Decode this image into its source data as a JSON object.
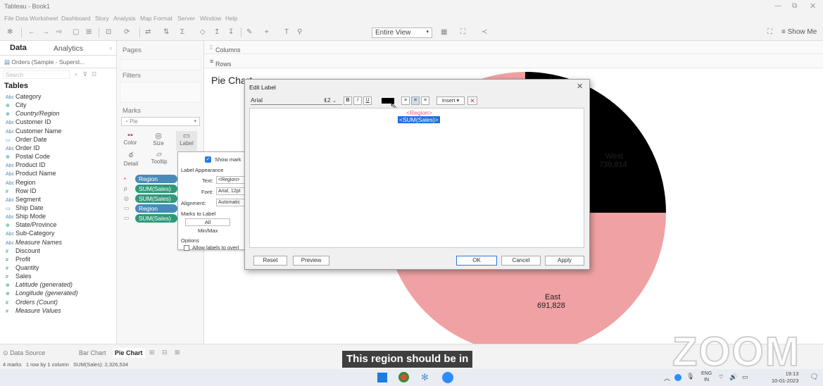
{
  "window": {
    "title": "Tableau - Book1"
  },
  "menubar": {
    "items": [
      "File",
      "Data",
      "Worksheet",
      "Dashboard",
      "Story",
      "Analysis",
      "Map",
      "Format",
      "Server",
      "Window",
      "Help"
    ]
  },
  "toolbar": {
    "view_select": "Entire View",
    "show_me": "Show Me"
  },
  "left_pane": {
    "tab_data": "Data",
    "tab_analytics": "Analytics",
    "datasource": "Orders (Sample - Superst...",
    "search_placeholder": "Search",
    "tables_header": "Tables",
    "fields": [
      {
        "icon": "Abc",
        "label": "Category"
      },
      {
        "icon": "⊕",
        "label": "City"
      },
      {
        "icon": "⊕",
        "label": "Country/Region"
      },
      {
        "icon": "Abc",
        "label": "Customer ID"
      },
      {
        "icon": "Abc",
        "label": "Customer Name"
      },
      {
        "icon": "▭",
        "label": "Order Date"
      },
      {
        "icon": "Abc",
        "label": "Order ID"
      },
      {
        "icon": "⊕",
        "label": "Postal Code"
      },
      {
        "icon": "Abc",
        "label": "Product ID"
      },
      {
        "icon": "Abc",
        "label": "Product Name"
      },
      {
        "icon": "Abc",
        "label": "Region"
      },
      {
        "icon": "#",
        "label": "Row ID"
      },
      {
        "icon": "Abc",
        "label": "Segment"
      },
      {
        "icon": "▭",
        "label": "Ship Date"
      },
      {
        "icon": "Abc",
        "label": "Ship Mode"
      },
      {
        "icon": "⊕",
        "label": "State/Province"
      },
      {
        "icon": "Abc",
        "label": "Sub-Category"
      },
      {
        "icon": "Abc",
        "label": "Measure Names"
      },
      {
        "icon": "#",
        "label": "Discount"
      },
      {
        "icon": "#",
        "label": "Profit"
      },
      {
        "icon": "#",
        "label": "Quantity"
      },
      {
        "icon": "#",
        "label": "Sales"
      },
      {
        "icon": "⊕",
        "label": "Latitude (generated)"
      },
      {
        "icon": "⊕",
        "label": "Longitude (generated)"
      },
      {
        "icon": "#",
        "label": "Orders (Count)"
      },
      {
        "icon": "#",
        "label": "Measure Values"
      }
    ]
  },
  "mid_pane": {
    "pages": "Pages",
    "filters": "Filters",
    "marks": "Marks",
    "mark_type": "Pie",
    "buttons": [
      "Color",
      "Size",
      "Label",
      "Detail",
      "Tooltip"
    ],
    "pills": [
      {
        "label": "Region",
        "color": "blue"
      },
      {
        "label": "SUM(Sales)",
        "color": "green"
      },
      {
        "label": "SUM(Sales)",
        "color": "green"
      },
      {
        "label": "Region",
        "color": "blue"
      },
      {
        "label": "SUM(Sales)",
        "color": "green"
      }
    ]
  },
  "shelves": {
    "columns": "Columns",
    "rows": "Rows"
  },
  "view": {
    "title": "Pie Chart"
  },
  "pie_labels": {
    "west_region": "West",
    "west_value": "739,814",
    "east_region": "East",
    "east_value": "691,828"
  },
  "label_popup": {
    "show_mark": "Show mark",
    "appearance": "Label Appearance",
    "text_label": "Text:",
    "text_value": "<Region>",
    "font_label": "Font:",
    "font_value": "Arial, 12pt",
    "align_label": "Alignment:",
    "align_value": "Automatic",
    "marks_to_label": "Marks to Label",
    "all": "All",
    "minmax": "Min/Max",
    "options": "Options",
    "allow": "Allow labels to overl"
  },
  "dialog": {
    "title": "Edit Label",
    "font": "Arial",
    "size": "12",
    "insert": "Insert",
    "line1": "<Region>",
    "line2": "<SUM(Sales)>",
    "reset": "Reset",
    "preview": "Preview",
    "ok": "OK",
    "cancel": "Cancel",
    "apply": "Apply"
  },
  "sheet_tabs": {
    "datasource": "Data Source",
    "tabs": [
      "Bar Chart",
      "Pie Chart"
    ]
  },
  "status": {
    "text": "4 marks   1 row by 1 column   SUM(Sales): 2,326,534"
  },
  "caption": "This region should be in",
  "zoom_logo": "ZOOM",
  "taskbar": {
    "lang": "ENG",
    "lang2": "IN",
    "time": "19:13",
    "date": "10-01-2023"
  },
  "colors": {
    "west_slice": "#000000",
    "east_slice": "#f0a1a3",
    "pill_blue": "#4a8ab8",
    "pill_green": "#2e9a7a",
    "selection": "#1e6fd9"
  }
}
